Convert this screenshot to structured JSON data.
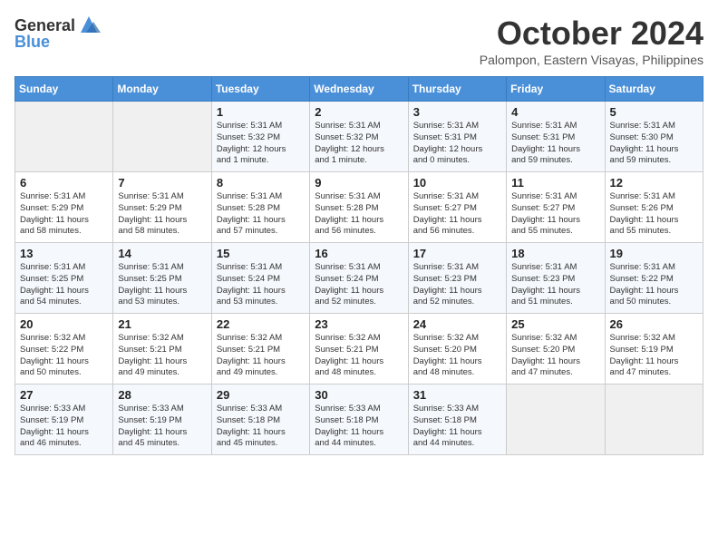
{
  "logo": {
    "general": "General",
    "blue": "Blue"
  },
  "header": {
    "month": "October 2024",
    "location": "Palompon, Eastern Visayas, Philippines"
  },
  "days_of_week": [
    "Sunday",
    "Monday",
    "Tuesday",
    "Wednesday",
    "Thursday",
    "Friday",
    "Saturday"
  ],
  "weeks": [
    [
      {
        "day": "",
        "info": ""
      },
      {
        "day": "",
        "info": ""
      },
      {
        "day": "1",
        "info": "Sunrise: 5:31 AM\nSunset: 5:32 PM\nDaylight: 12 hours\nand 1 minute."
      },
      {
        "day": "2",
        "info": "Sunrise: 5:31 AM\nSunset: 5:32 PM\nDaylight: 12 hours\nand 1 minute."
      },
      {
        "day": "3",
        "info": "Sunrise: 5:31 AM\nSunset: 5:31 PM\nDaylight: 12 hours\nand 0 minutes."
      },
      {
        "day": "4",
        "info": "Sunrise: 5:31 AM\nSunset: 5:31 PM\nDaylight: 11 hours\nand 59 minutes."
      },
      {
        "day": "5",
        "info": "Sunrise: 5:31 AM\nSunset: 5:30 PM\nDaylight: 11 hours\nand 59 minutes."
      }
    ],
    [
      {
        "day": "6",
        "info": "Sunrise: 5:31 AM\nSunset: 5:29 PM\nDaylight: 11 hours\nand 58 minutes."
      },
      {
        "day": "7",
        "info": "Sunrise: 5:31 AM\nSunset: 5:29 PM\nDaylight: 11 hours\nand 58 minutes."
      },
      {
        "day": "8",
        "info": "Sunrise: 5:31 AM\nSunset: 5:28 PM\nDaylight: 11 hours\nand 57 minutes."
      },
      {
        "day": "9",
        "info": "Sunrise: 5:31 AM\nSunset: 5:28 PM\nDaylight: 11 hours\nand 56 minutes."
      },
      {
        "day": "10",
        "info": "Sunrise: 5:31 AM\nSunset: 5:27 PM\nDaylight: 11 hours\nand 56 minutes."
      },
      {
        "day": "11",
        "info": "Sunrise: 5:31 AM\nSunset: 5:27 PM\nDaylight: 11 hours\nand 55 minutes."
      },
      {
        "day": "12",
        "info": "Sunrise: 5:31 AM\nSunset: 5:26 PM\nDaylight: 11 hours\nand 55 minutes."
      }
    ],
    [
      {
        "day": "13",
        "info": "Sunrise: 5:31 AM\nSunset: 5:25 PM\nDaylight: 11 hours\nand 54 minutes."
      },
      {
        "day": "14",
        "info": "Sunrise: 5:31 AM\nSunset: 5:25 PM\nDaylight: 11 hours\nand 53 minutes."
      },
      {
        "day": "15",
        "info": "Sunrise: 5:31 AM\nSunset: 5:24 PM\nDaylight: 11 hours\nand 53 minutes."
      },
      {
        "day": "16",
        "info": "Sunrise: 5:31 AM\nSunset: 5:24 PM\nDaylight: 11 hours\nand 52 minutes."
      },
      {
        "day": "17",
        "info": "Sunrise: 5:31 AM\nSunset: 5:23 PM\nDaylight: 11 hours\nand 52 minutes."
      },
      {
        "day": "18",
        "info": "Sunrise: 5:31 AM\nSunset: 5:23 PM\nDaylight: 11 hours\nand 51 minutes."
      },
      {
        "day": "19",
        "info": "Sunrise: 5:31 AM\nSunset: 5:22 PM\nDaylight: 11 hours\nand 50 minutes."
      }
    ],
    [
      {
        "day": "20",
        "info": "Sunrise: 5:32 AM\nSunset: 5:22 PM\nDaylight: 11 hours\nand 50 minutes."
      },
      {
        "day": "21",
        "info": "Sunrise: 5:32 AM\nSunset: 5:21 PM\nDaylight: 11 hours\nand 49 minutes."
      },
      {
        "day": "22",
        "info": "Sunrise: 5:32 AM\nSunset: 5:21 PM\nDaylight: 11 hours\nand 49 minutes."
      },
      {
        "day": "23",
        "info": "Sunrise: 5:32 AM\nSunset: 5:21 PM\nDaylight: 11 hours\nand 48 minutes."
      },
      {
        "day": "24",
        "info": "Sunrise: 5:32 AM\nSunset: 5:20 PM\nDaylight: 11 hours\nand 48 minutes."
      },
      {
        "day": "25",
        "info": "Sunrise: 5:32 AM\nSunset: 5:20 PM\nDaylight: 11 hours\nand 47 minutes."
      },
      {
        "day": "26",
        "info": "Sunrise: 5:32 AM\nSunset: 5:19 PM\nDaylight: 11 hours\nand 47 minutes."
      }
    ],
    [
      {
        "day": "27",
        "info": "Sunrise: 5:33 AM\nSunset: 5:19 PM\nDaylight: 11 hours\nand 46 minutes."
      },
      {
        "day": "28",
        "info": "Sunrise: 5:33 AM\nSunset: 5:19 PM\nDaylight: 11 hours\nand 45 minutes."
      },
      {
        "day": "29",
        "info": "Sunrise: 5:33 AM\nSunset: 5:18 PM\nDaylight: 11 hours\nand 45 minutes."
      },
      {
        "day": "30",
        "info": "Sunrise: 5:33 AM\nSunset: 5:18 PM\nDaylight: 11 hours\nand 44 minutes."
      },
      {
        "day": "31",
        "info": "Sunrise: 5:33 AM\nSunset: 5:18 PM\nDaylight: 11 hours\nand 44 minutes."
      },
      {
        "day": "",
        "info": ""
      },
      {
        "day": "",
        "info": ""
      }
    ]
  ]
}
